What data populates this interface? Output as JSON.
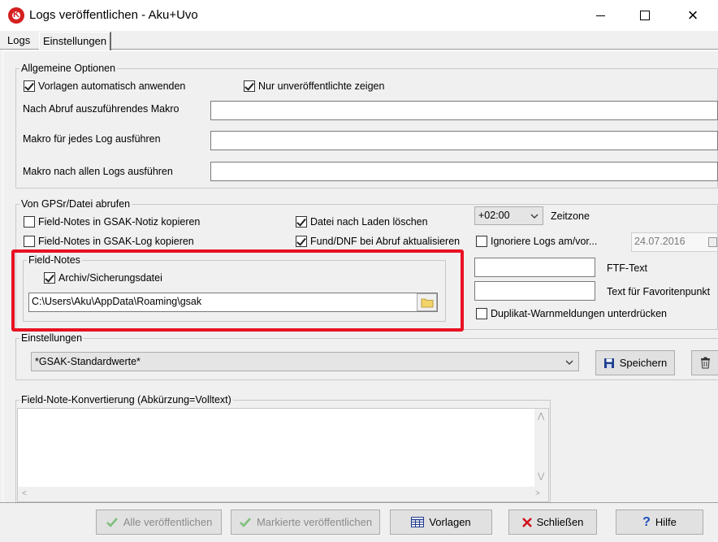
{
  "window": {
    "title": "Logs veröffentlichen - Aku+Uvo",
    "minimize": "minimize",
    "maximize": "maximize",
    "close": "×"
  },
  "tabs": [
    {
      "label": "Logs"
    },
    {
      "label": "Einstellungen"
    }
  ],
  "general": {
    "title": "Allgemeine Optionen",
    "apply_templates": "Vorlagen automatisch anwenden",
    "only_unpublished": "Nur unveröffentlichte zeigen",
    "macro_after_fetch": "Nach Abruf auszuführendes Makro",
    "macro_each_log": "Makro für jedes Log ausführen",
    "macro_after_all": "Makro nach allen Logs ausführen",
    "macro_after_fetch_value": "",
    "macro_each_log_value": "",
    "macro_after_all_value": ""
  },
  "gps": {
    "title": "Von GPSr/Datei abrufen",
    "fn_to_note": "Field-Notes in GSAK-Notiz kopieren",
    "fn_to_log": "Field-Notes in GSAK-Log kopieren",
    "delete_after_load": "Datei nach Laden löschen",
    "update_fund_dnf": "Fund/DNF bei Abruf aktualisieren",
    "timezone_value": "+02:00",
    "timezone_label": "Zeitzone",
    "ignore_logs": "Ignoriere Logs am/vor...",
    "ignore_date": "24.07.2016",
    "ftf_label": "FTF-Text",
    "ftf_value": "",
    "fav_label": "Text für Favoritenpunkt",
    "fav_value": "",
    "dup_warn": "Duplikat-Warnmeldungen unterdrücken"
  },
  "fieldnotes": {
    "title": "Field-Notes",
    "archive": "Archiv/Sicherungsdatei",
    "path": "C:\\Users\\Aku\\AppData\\Roaming\\gsak"
  },
  "settings": {
    "title": "Einstellungen",
    "preset": "*GSAK-Standardwerte*",
    "save": "Speichern"
  },
  "conversion": {
    "title": "Field-Note-Konvertierung (Abkürzung=Volltext)",
    "content": ""
  },
  "footer": {
    "publish_all": "Alle veröffentlichen",
    "publish_marked": "Markierte veröffentlichen",
    "templates": "Vorlagen",
    "close": "Schließen",
    "help": "Hilfe"
  },
  "colors": {
    "highlight": "#e81123",
    "accent": "#0078d7",
    "check_green": "#2a9a2a"
  }
}
